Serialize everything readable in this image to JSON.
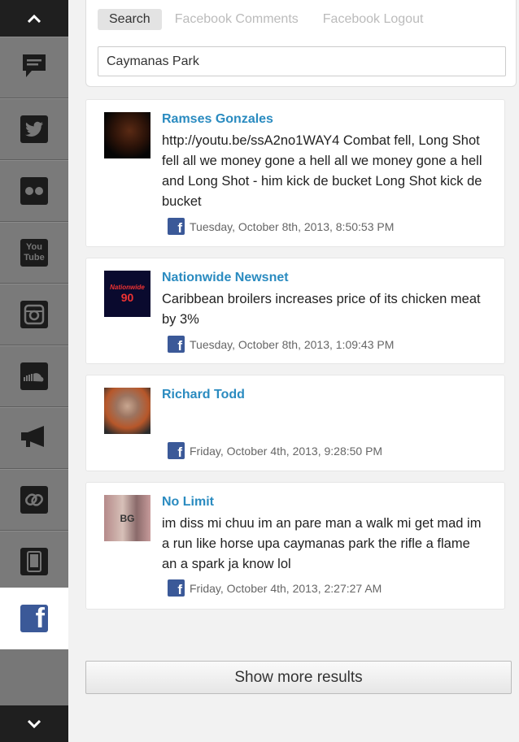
{
  "search": {
    "tabs": [
      {
        "label": "Search",
        "active": true
      },
      {
        "label": "Facebook Comments",
        "active": false
      },
      {
        "label": "Facebook Logout",
        "active": false
      }
    ],
    "query": "Caymanas Park"
  },
  "sidebar": {
    "items": [
      {
        "icon": "comment-icon",
        "active": false
      },
      {
        "icon": "twitter-icon",
        "active": false
      },
      {
        "icon": "flickr-icon",
        "active": false
      },
      {
        "icon": "youtube-icon",
        "active": false
      },
      {
        "icon": "instagram-icon",
        "active": false
      },
      {
        "icon": "soundcloud-icon",
        "active": false
      },
      {
        "icon": "megaphone-icon",
        "active": false
      },
      {
        "icon": "link-icon",
        "active": false
      },
      {
        "icon": "tablet-icon",
        "active": false
      },
      {
        "icon": "facebook-icon",
        "active": true
      }
    ],
    "youtube_text_1": "You",
    "youtube_text_2": "Tube",
    "facebook_glyph": "f"
  },
  "posts": [
    {
      "author": "Ramses Gonzales",
      "text": "http://youtu.be/ssA2no1WAY4 Combat fell, Long Shot fell all we money gone a hell all we money gone a hell and Long Shot - him kick de bucket Long Shot kick de bucket",
      "time": "Tuesday, October 8th, 2013, 8:50:53 PM"
    },
    {
      "author": "Nationwide Newsnet",
      "text": "Caribbean broilers increases price of its chicken meat by 3%",
      "time": "Tuesday, October 8th, 2013, 1:09:43 PM"
    },
    {
      "author": "Richard Todd",
      "text": "",
      "time": "Friday, October 4th, 2013, 9:28:50 PM"
    },
    {
      "author": "No Limit",
      "text": "im diss mi chuu im an pare man a walk mi get mad im a run like horse upa caymanas park the rifle a flame an a spark ja know lol",
      "time": "Friday, October 4th, 2013, 2:27:27 AM"
    }
  ],
  "avatar_text": {
    "nationwide_1": "Nationwide",
    "nationwide_2": "90",
    "nolimit": "BG"
  },
  "more_button_label": "Show more results",
  "colors": {
    "link": "#2a8bc0",
    "facebook": "#3b5998",
    "sidebar": "#777777",
    "sidebar_dark": "#1f1f1f"
  }
}
